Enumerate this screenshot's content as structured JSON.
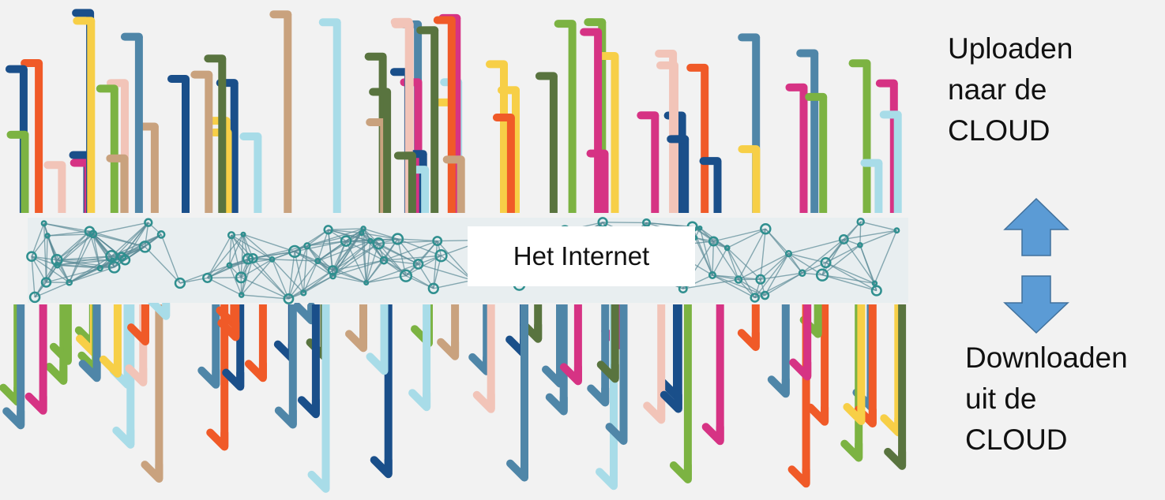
{
  "internet_label": "Het Internet",
  "upload": {
    "lines": [
      "Uploaden",
      "naar de",
      "CLOUD"
    ],
    "icon": "up-arrow-icon",
    "color": "#5b9bd5"
  },
  "download": {
    "lines": [
      "Downloaden",
      "uit de",
      "CLOUD"
    ],
    "icon": "down-arrow-icon",
    "color": "#5b9bd5"
  },
  "arrow_palette": [
    "#4f86a8",
    "#f7cf47",
    "#d63384",
    "#f05a28",
    "#7cb342",
    "#1a4f8a",
    "#c9a27e",
    "#59743f",
    "#a8dce8",
    "#f2c4b8"
  ],
  "network_colors": {
    "node": "#2f8f8f",
    "line": "#5a8a96",
    "band_background": "#e8eef0"
  }
}
